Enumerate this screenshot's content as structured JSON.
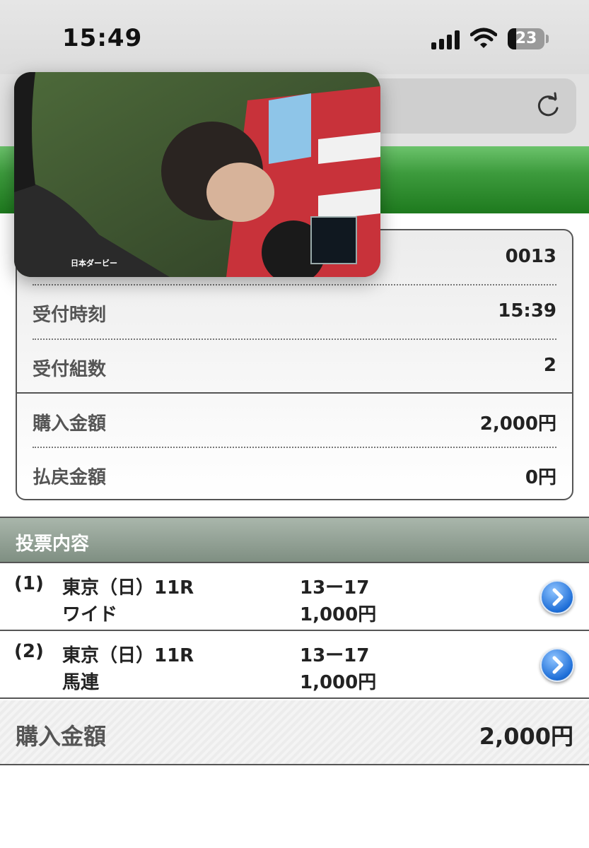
{
  "status_bar": {
    "time": "15:49",
    "battery": "23"
  },
  "receipt": {
    "rows": [
      {
        "label": "",
        "value": "0013"
      },
      {
        "label": "受付時刻",
        "value": "15:39"
      },
      {
        "label": "受付組数",
        "value": "2"
      },
      {
        "label": "購入金額",
        "value": "2,000円"
      },
      {
        "label": "払戻金額",
        "value": "0円"
      }
    ]
  },
  "vote": {
    "title": "投票内容",
    "bets": [
      {
        "index": "(1)",
        "race": "東京（日）11R",
        "type": "ワイド",
        "combo": "13ー17",
        "amount": "1,000円"
      },
      {
        "index": "(2)",
        "race": "東京（日）11R",
        "type": "馬連",
        "combo": "13ー17",
        "amount": "1,000円"
      }
    ]
  },
  "total": {
    "label": "購入金額",
    "value": "2,000円"
  },
  "video": {
    "caption": "日本ダービー"
  },
  "colors": {
    "header_green": "#2e8b2e",
    "vote_header": "#8a9a8c",
    "link_blue": "#1f6fd8"
  }
}
